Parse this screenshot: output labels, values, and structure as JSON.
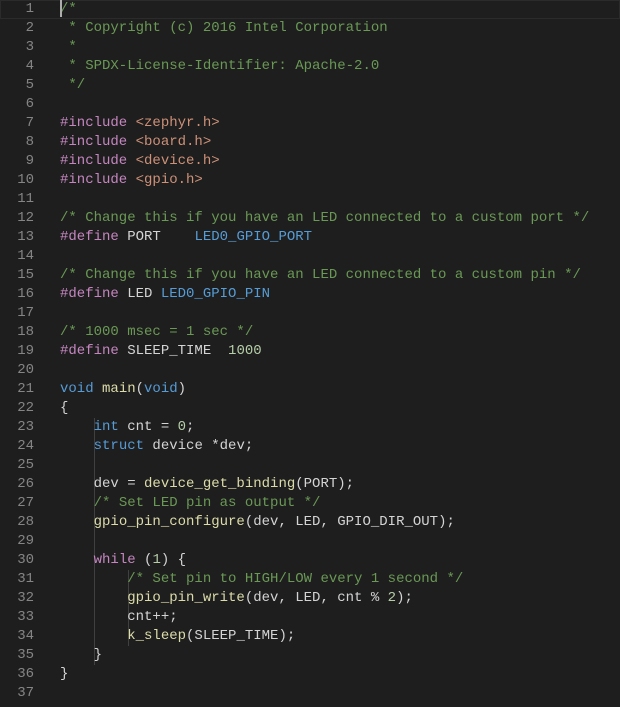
{
  "editor": {
    "lines": [
      [
        {
          "t": "/*",
          "c": "c-comment"
        }
      ],
      [
        {
          "t": " * Copyright (c) 2016 Intel Corporation",
          "c": "c-comment"
        }
      ],
      [
        {
          "t": " *",
          "c": "c-comment"
        }
      ],
      [
        {
          "t": " * SPDX-License-Identifier: Apache-2.0",
          "c": "c-comment"
        }
      ],
      [
        {
          "t": " */",
          "c": "c-comment"
        }
      ],
      [],
      [
        {
          "t": "#include ",
          "c": "c-dir"
        },
        {
          "t": "<zephyr.h>",
          "c": "c-str"
        }
      ],
      [
        {
          "t": "#include ",
          "c": "c-dir"
        },
        {
          "t": "<board.h>",
          "c": "c-str"
        }
      ],
      [
        {
          "t": "#include ",
          "c": "c-dir"
        },
        {
          "t": "<device.h>",
          "c": "c-str"
        }
      ],
      [
        {
          "t": "#include ",
          "c": "c-dir"
        },
        {
          "t": "<gpio.h>",
          "c": "c-str"
        }
      ],
      [],
      [
        {
          "t": "/* Change this if you have an LED connected to a custom port */",
          "c": "c-comment"
        }
      ],
      [
        {
          "t": "#define ",
          "c": "c-dir"
        },
        {
          "t": "PORT    ",
          "c": "c-plain"
        },
        {
          "t": "LED0_GPIO_PORT",
          "c": "c-macro"
        }
      ],
      [],
      [
        {
          "t": "/* Change this if you have an LED connected to a custom pin */",
          "c": "c-comment"
        }
      ],
      [
        {
          "t": "#define ",
          "c": "c-dir"
        },
        {
          "t": "LED ",
          "c": "c-plain"
        },
        {
          "t": "LED0_GPIO_PIN",
          "c": "c-macro"
        }
      ],
      [],
      [
        {
          "t": "/* 1000 msec = 1 sec */",
          "c": "c-comment"
        }
      ],
      [
        {
          "t": "#define ",
          "c": "c-dir"
        },
        {
          "t": "SLEEP_TIME  ",
          "c": "c-plain"
        },
        {
          "t": "1000",
          "c": "c-num"
        }
      ],
      [],
      [
        {
          "t": "void ",
          "c": "c-kw"
        },
        {
          "t": "main",
          "c": "c-fn"
        },
        {
          "t": "(",
          "c": "c-plain"
        },
        {
          "t": "void",
          "c": "c-kw"
        },
        {
          "t": ")",
          "c": "c-plain"
        }
      ],
      [
        {
          "t": "{",
          "c": "c-plain"
        }
      ],
      [
        {
          "t": "    ",
          "c": "c-plain"
        },
        {
          "t": "int",
          "c": "c-kw"
        },
        {
          "t": " cnt = ",
          "c": "c-plain"
        },
        {
          "t": "0",
          "c": "c-num"
        },
        {
          "t": ";",
          "c": "c-plain"
        }
      ],
      [
        {
          "t": "    ",
          "c": "c-plain"
        },
        {
          "t": "struct",
          "c": "c-kw"
        },
        {
          "t": " device *dev;",
          "c": "c-plain"
        }
      ],
      [],
      [
        {
          "t": "    dev = ",
          "c": "c-plain"
        },
        {
          "t": "device_get_binding",
          "c": "c-fn"
        },
        {
          "t": "(PORT);",
          "c": "c-plain"
        }
      ],
      [
        {
          "t": "    ",
          "c": "c-plain"
        },
        {
          "t": "/* Set LED pin as output */",
          "c": "c-comment"
        }
      ],
      [
        {
          "t": "    ",
          "c": "c-plain"
        },
        {
          "t": "gpio_pin_configure",
          "c": "c-fn"
        },
        {
          "t": "(dev, LED, GPIO_DIR_OUT);",
          "c": "c-plain"
        }
      ],
      [],
      [
        {
          "t": "    ",
          "c": "c-plain"
        },
        {
          "t": "while",
          "c": "c-dir"
        },
        {
          "t": " (",
          "c": "c-plain"
        },
        {
          "t": "1",
          "c": "c-num"
        },
        {
          "t": ") {",
          "c": "c-plain"
        }
      ],
      [
        {
          "t": "        ",
          "c": "c-plain"
        },
        {
          "t": "/* Set pin to HIGH/LOW every 1 second */",
          "c": "c-comment"
        }
      ],
      [
        {
          "t": "        ",
          "c": "c-plain"
        },
        {
          "t": "gpio_pin_write",
          "c": "c-fn"
        },
        {
          "t": "(dev, LED, cnt % ",
          "c": "c-plain"
        },
        {
          "t": "2",
          "c": "c-num"
        },
        {
          "t": ");",
          "c": "c-plain"
        }
      ],
      [
        {
          "t": "        cnt++;",
          "c": "c-plain"
        }
      ],
      [
        {
          "t": "        ",
          "c": "c-plain"
        },
        {
          "t": "k_sleep",
          "c": "c-fn"
        },
        {
          "t": "(SLEEP_TIME);",
          "c": "c-plain"
        }
      ],
      [
        {
          "t": "    }",
          "c": "c-plain"
        }
      ],
      [
        {
          "t": "}",
          "c": "c-plain"
        }
      ],
      []
    ]
  }
}
